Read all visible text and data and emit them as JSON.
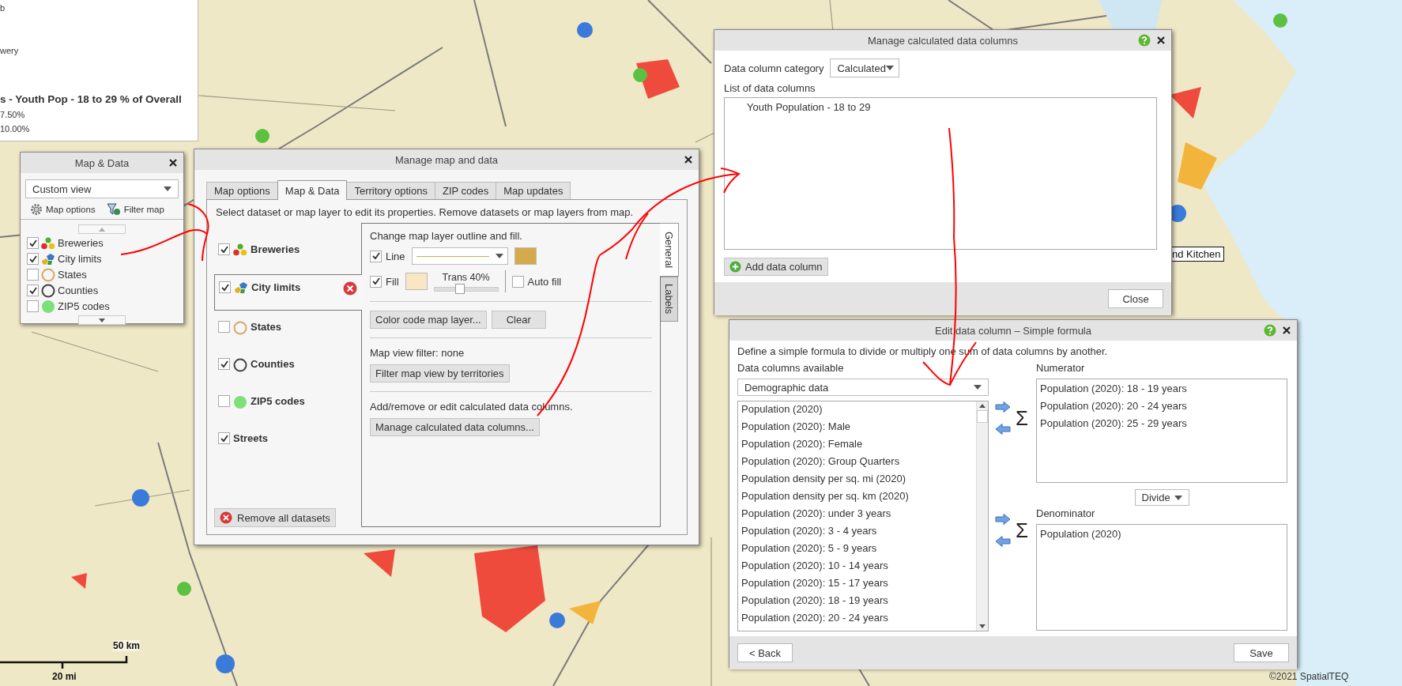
{
  "legend": {
    "lines": [
      "b",
      "wery"
    ],
    "title": "s - Youth Pop - 18 to 29 % of Overall",
    "ranges": [
      "7.50%",
      "10.00%"
    ]
  },
  "map": {
    "tooltip": "nd Kitchen",
    "scale_km": "50 km",
    "scale_mi": "20 mi",
    "copyright": "©2021 SpatialTEQ"
  },
  "map_data_panel": {
    "title": "Map & Data",
    "view": "Custom view",
    "tools": [
      {
        "kind": "options",
        "label": "Map options"
      },
      {
        "kind": "filter",
        "label": "Filter map"
      }
    ],
    "layers": [
      {
        "kind": "breweries",
        "label": "Breweries",
        "checked": true
      },
      {
        "kind": "city",
        "label": "City limits",
        "checked": true
      },
      {
        "kind": "states",
        "label": "States",
        "checked": false
      },
      {
        "kind": "counties",
        "label": "Counties",
        "checked": true
      },
      {
        "kind": "zip",
        "label": "ZIP5 codes",
        "checked": false
      }
    ]
  },
  "manage_map_dialog": {
    "title": "Manage map and data",
    "tabs": [
      {
        "label": "Map options",
        "selected": false
      },
      {
        "label": "Map & Data",
        "selected": true
      },
      {
        "label": "Territory options",
        "selected": false
      },
      {
        "label": "ZIP codes",
        "selected": false
      },
      {
        "label": "Map updates",
        "selected": false
      }
    ],
    "instructions": "Select dataset or map layer to edit its properties. Remove datasets or map layers from map.",
    "layers": [
      {
        "kind": "breweries",
        "label": "Breweries",
        "checked": true,
        "selected": false
      },
      {
        "kind": "city",
        "label": "City limits",
        "checked": true,
        "selected": true
      },
      {
        "kind": "states",
        "label": "States",
        "checked": false,
        "selected": false
      },
      {
        "kind": "counties",
        "label": "Counties",
        "checked": true,
        "selected": false
      },
      {
        "kind": "zip",
        "label": "ZIP5 codes",
        "checked": false,
        "selected": false
      },
      {
        "kind": "streets",
        "label": "Streets",
        "checked": true,
        "selected": false
      }
    ],
    "remove_all": "Remove all datasets",
    "general": {
      "heading": "Change map layer outline and fill.",
      "line": {
        "label": "Line",
        "checked": true
      },
      "fill": {
        "label": "Fill",
        "checked": true
      },
      "trans": {
        "label": "Trans 40%",
        "level": 0.4
      },
      "auto_fill": {
        "label": "Auto fill",
        "checked": false
      },
      "buttons": [
        "Color code map layer...",
        "Clear"
      ],
      "filter_text": "Map view filter: none",
      "filter_button": "Filter map view by territories",
      "calc_text": "Add/remove or edit calculated data columns.",
      "calc_button": "Manage calculated data columns..."
    },
    "side_tabs": [
      {
        "label": "General",
        "selected": true
      },
      {
        "label": "Labels",
        "selected": false
      }
    ]
  },
  "calc_dialog": {
    "title": "Manage calculated data columns",
    "category_label": "Data column category",
    "category": "Calculated",
    "list_label": "List of data columns",
    "columns": [
      "Youth Population - 18 to 29"
    ],
    "add_button": "Add data column",
    "close_button": "Close"
  },
  "edit_dialog": {
    "title": "Edit data column – Simple formula",
    "description": "Define a simple formula to divide or multiply one sum of data columns by another.",
    "available_label": "Data columns available",
    "source": "Demographic data",
    "available": [
      "Population (2020)",
      "Population (2020): Male",
      "Population (2020): Female",
      "Population (2020): Group Quarters",
      "Population density per sq. mi (2020)",
      "Population density per sq. km (2020)",
      "Population (2020): under 3 years",
      "Population (2020): 3 - 4 years",
      "Population (2020): 5 - 9 years",
      "Population (2020): 10 - 14 years",
      "Population (2020): 15 - 17 years",
      "Population (2020): 18 - 19 years",
      "Population (2020): 20 - 24 years"
    ],
    "numerator_label": "Numerator",
    "numerator": [
      "Population (2020): 18 - 19 years",
      "Population (2020): 20 - 24 years",
      "Population (2020): 25 - 29 years"
    ],
    "operation": "Divide",
    "denominator_label": "Denominator",
    "denominator": [
      "Population (2020)"
    ],
    "sigmas": [
      "Σ",
      "Σ"
    ],
    "back_button": "< Back",
    "save_button": "Save"
  }
}
